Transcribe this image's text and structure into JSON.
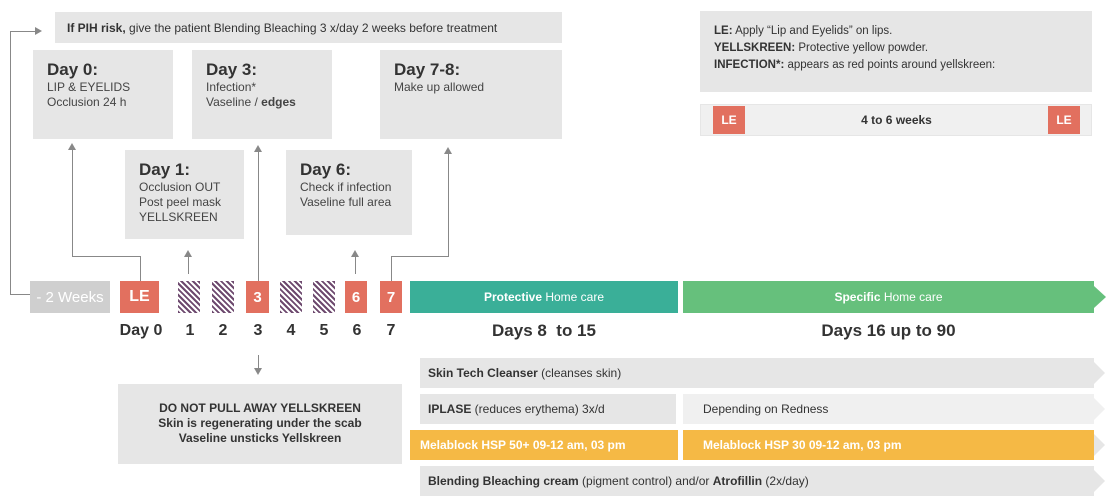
{
  "pih": {
    "bold": "If PIH risk,",
    "rest": " give the patient Blending Bleaching 3 x/day 2 weeks before treatment"
  },
  "day0": {
    "title": "Day 0:",
    "line1": "LIP & EYELIDS",
    "line2": "Occlusion 24 h"
  },
  "day3": {
    "title": "Day 3:",
    "line1": "Infection*",
    "line2a": "Vaseline / ",
    "line2b": "edges"
  },
  "day78": {
    "title": "Day 7-8:",
    "line1": "Make up allowed"
  },
  "day1": {
    "title": "Day 1:",
    "line1": "Occlusion OUT",
    "line2": "Post peel mask",
    "line3": "YELLSKREEN"
  },
  "day6": {
    "title": "Day 6:",
    "line1": "Check if infection",
    "line2": "Vaseline full area"
  },
  "legend": {
    "le_bold": "LE:",
    "le_rest": " Apply “Lip and Eyelids” on lips.",
    "ys_bold": "YELLSKREEN:",
    "ys_rest": " Protective yellow powder.",
    "inf_bold": "INFECTION*:",
    "inf_rest": " appears as red points around yellskreen:"
  },
  "le_bar": {
    "left": "LE",
    "middle": "4 to 6 weeks",
    "right": "LE"
  },
  "timeline": {
    "weeks": "- 2 Weeks",
    "le": "LE",
    "day3": "3",
    "day6": "6",
    "day7": "7",
    "protective_bold": "Protective",
    "protective_rest": " Home care",
    "specific_bold": "Specific",
    "specific_rest": " Home care"
  },
  "day_labels": [
    "Day 0",
    "1",
    "2",
    "3",
    "4",
    "5",
    "6",
    "7"
  ],
  "ranges": {
    "first": "Days 8  to 15",
    "second": "Days 16 up to 90"
  },
  "warning": {
    "line1": "DO NOT PULL AWAY YELLSKREEN",
    "line2": "Skin is regenerating under the scab",
    "line3": "Vaseline unsticks Yellskreen"
  },
  "rows": {
    "cleanser_bold": "Skin Tech Cleanser",
    "cleanser_rest": " (cleanses skin)",
    "iplase_bold": "IPLASE",
    "iplase_rest": " (reduces erythema) 3x/d",
    "redness": "Depending on Redness",
    "mela1": "Melablock HSP 50+  09-12 am, 03 pm",
    "mela2": "Melablock HSP 30  09-12 am, 03 pm",
    "bb_bold": "Blending Bleaching cream",
    "bb_mid": " (pigment control) and/or ",
    "bb_bold2": "Atrofillin",
    "bb_rest": " (2x/day)"
  },
  "colors": {
    "red": "#e2705f",
    "teal": "#3aaf98",
    "green": "#66c07c",
    "yellow": "#f5b945",
    "hatch": "#6e4a6f",
    "box": "#e6e6e6"
  }
}
